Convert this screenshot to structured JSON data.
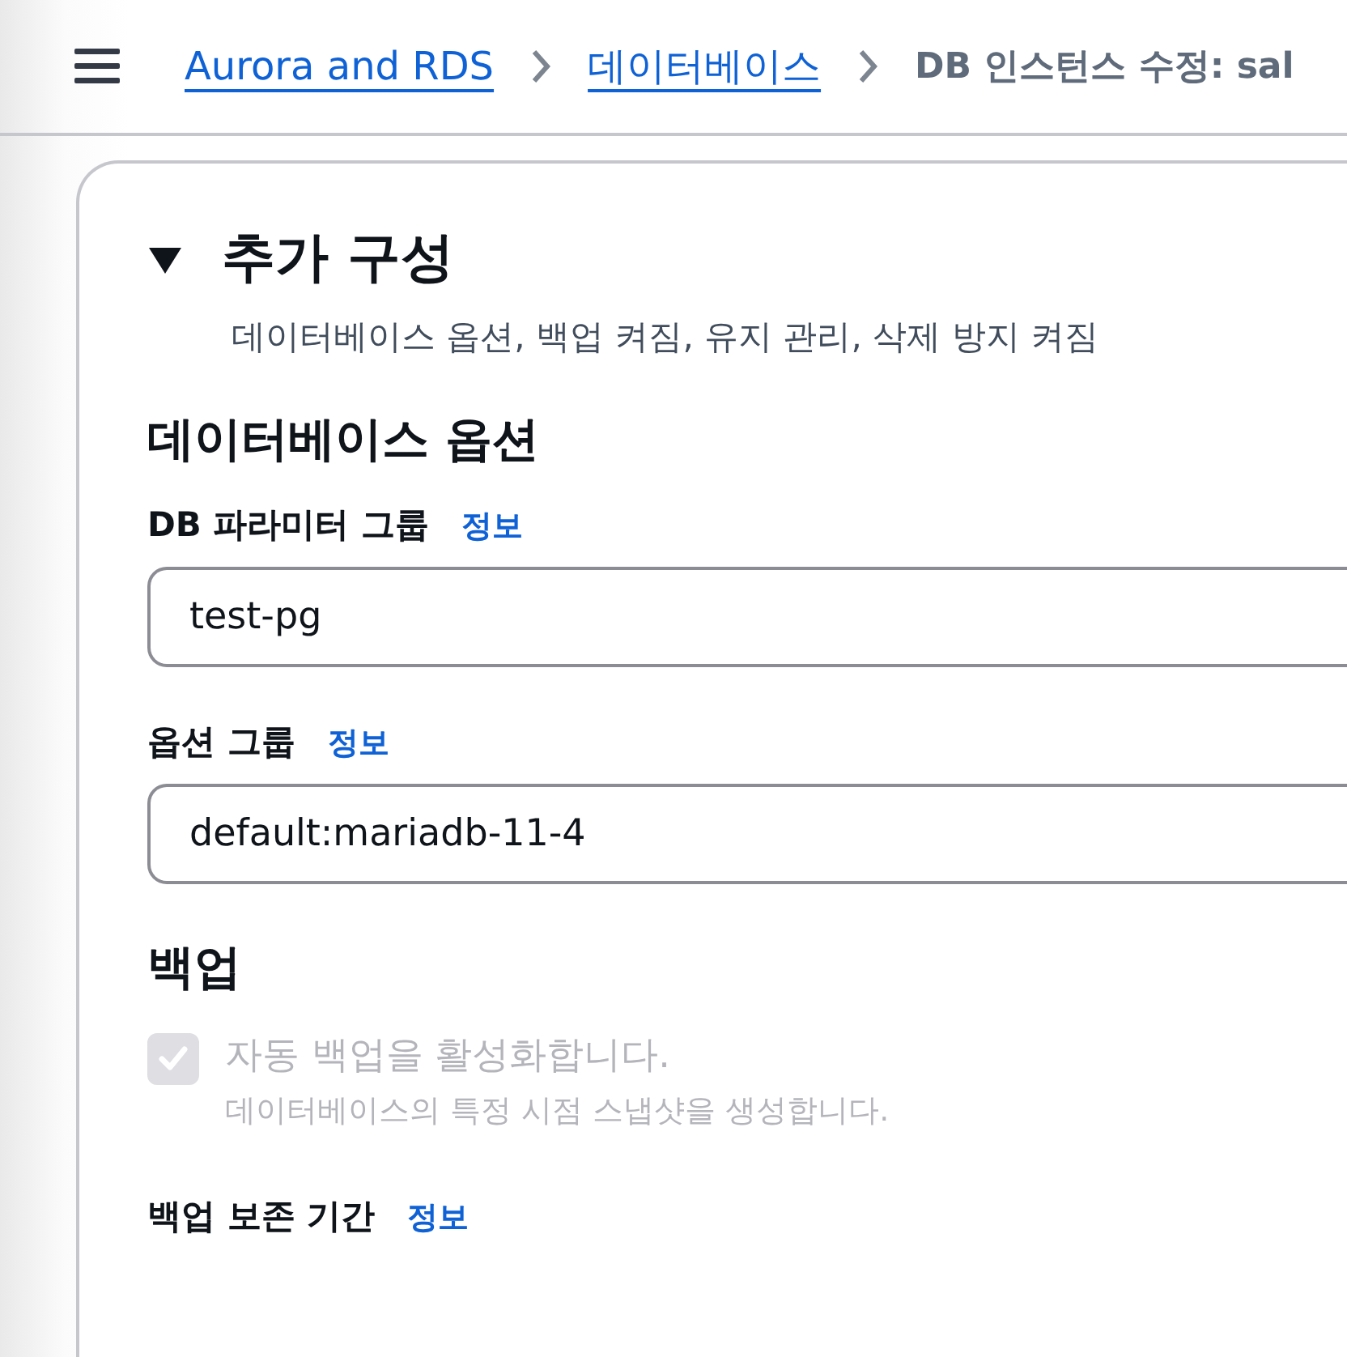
{
  "breadcrumbs": [
    {
      "label": "Aurora and RDS",
      "kind": "link"
    },
    {
      "label": "데이터베이스",
      "kind": "link"
    },
    {
      "label": "DB 인스턴스 수정: sal",
      "kind": "current"
    }
  ],
  "section": {
    "title": "추가 구성",
    "expanded": true,
    "description": "데이터베이스 옵션, 백업 켜짐, 유지 관리, 삭제 방지 켜짐"
  },
  "groups": [
    {
      "heading": "데이터베이스 옵션",
      "fields": [
        {
          "kind": "input",
          "label": "DB 파라미터 그룹",
          "info": "정보",
          "value": "test-pg"
        },
        {
          "kind": "input",
          "label": "옵션 그룹",
          "info": "정보",
          "value": "default:mariadb-11-4"
        }
      ]
    },
    {
      "heading": "백업",
      "fields": [
        {
          "kind": "checkbox",
          "label": "자동 백업을 활성화합니다.",
          "description": "데이터베이스의 특정 시점 스냅샷을 생성합니다.",
          "checked": true,
          "disabled": true
        },
        {
          "kind": "label",
          "label": "백업 보존 기간",
          "info": "정보"
        }
      ]
    }
  ]
}
